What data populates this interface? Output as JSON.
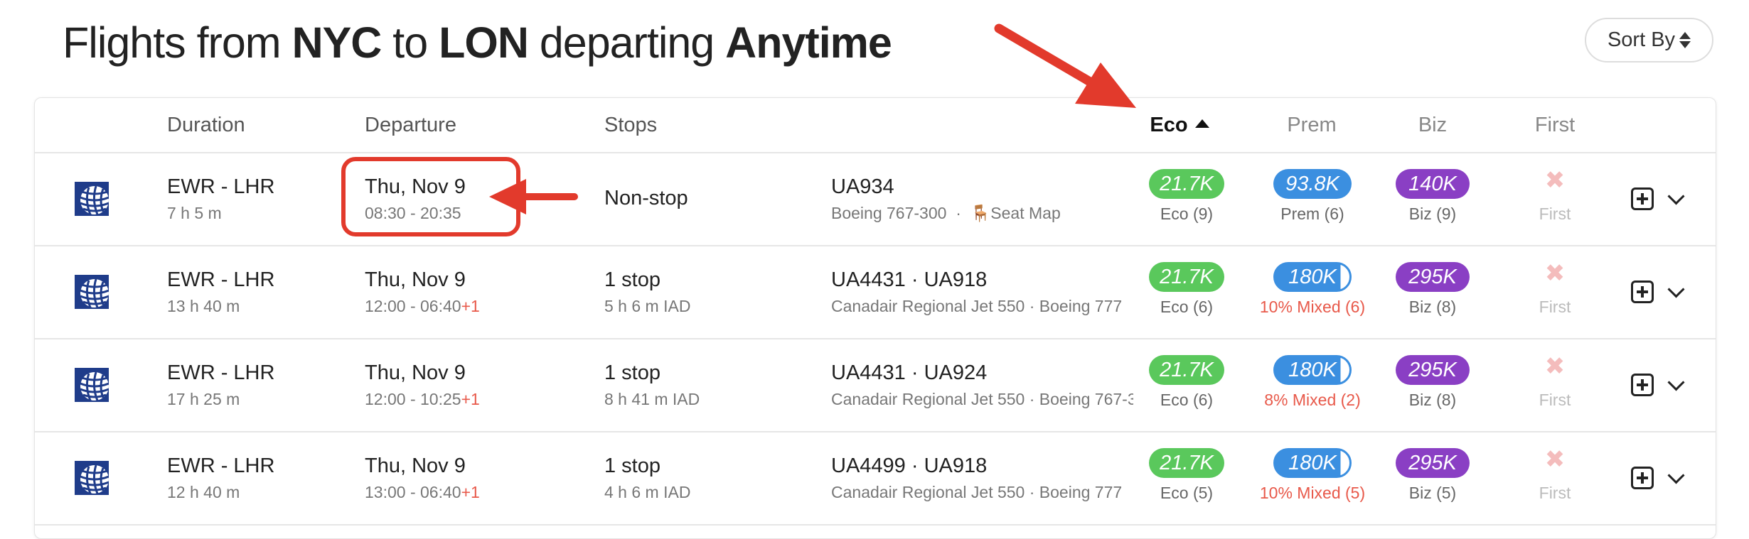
{
  "header": {
    "prefix": "Flights from ",
    "origin": "NYC",
    "mid": " to ",
    "destination": "LON",
    "mid2": " departing ",
    "when": "Anytime"
  },
  "sort_by_label": "Sort By",
  "columns": {
    "duration": "Duration",
    "departure": "Departure",
    "stops": "Stops",
    "eco": "Eco",
    "prem": "Prem",
    "biz": "Biz",
    "first": "First"
  },
  "flights": [
    {
      "route": "EWR - LHR",
      "duration": "7 h 5 m",
      "date": "Thu, Nov 9",
      "times": "08:30 - 20:35",
      "plus_day": "",
      "stops": "Non-stop",
      "stops_detail": "",
      "flight_numbers": "UA934",
      "aircraft": "Boeing 767-300",
      "sep": "·",
      "seat_map": "Seat Map",
      "eco": {
        "price": "21.7K",
        "label": "Eco (9)"
      },
      "prem": {
        "price": "93.8K",
        "label": "Prem (6)",
        "mixed": false
      },
      "biz": {
        "price": "140K",
        "label": "Biz (9)"
      },
      "first": {
        "label": "First"
      }
    },
    {
      "route": "EWR - LHR",
      "duration": "13 h 40 m",
      "date": "Thu, Nov 9",
      "times": "12:00 - 06:40",
      "plus_day": "+1",
      "stops": "1 stop",
      "stops_detail": "5 h 6 m  IAD",
      "flight_numbers": "UA4431  ·  UA918",
      "aircraft": "Canadair Regional Jet 550   ·   Boeing 777",
      "eco": {
        "price": "21.7K",
        "label": "Eco (6)"
      },
      "prem": {
        "price": "180K",
        "label": "10% Mixed (6)",
        "mixed": true
      },
      "biz": {
        "price": "295K",
        "label": "Biz (8)"
      },
      "first": {
        "label": "First"
      }
    },
    {
      "route": "EWR - LHR",
      "duration": "17 h 25 m",
      "date": "Thu, Nov 9",
      "times": "12:00 - 10:25",
      "plus_day": "+1",
      "stops": "1 stop",
      "stops_detail": "8 h 41 m  IAD",
      "flight_numbers": "UA4431  ·  UA924",
      "aircraft": "Canadair Regional Jet 550   ·   Boeing 767-3",
      "eco": {
        "price": "21.7K",
        "label": "Eco (6)"
      },
      "prem": {
        "price": "180K",
        "label": "8% Mixed (2)",
        "mixed": true
      },
      "biz": {
        "price": "295K",
        "label": "Biz (8)"
      },
      "first": {
        "label": "First"
      }
    },
    {
      "route": "EWR - LHR",
      "duration": "12 h 40 m",
      "date": "Thu, Nov 9",
      "times": "13:00 - 06:40",
      "plus_day": "+1",
      "stops": "1 stop",
      "stops_detail": "4 h 6 m  IAD",
      "flight_numbers": "UA4499  ·  UA918",
      "aircraft": "Canadair Regional Jet 550   ·   Boeing 777",
      "eco": {
        "price": "21.7K",
        "label": "Eco (5)"
      },
      "prem": {
        "price": "180K",
        "label": "10% Mixed (5)",
        "mixed": true
      },
      "biz": {
        "price": "295K",
        "label": "Biz (5)"
      },
      "first": {
        "label": "First"
      }
    }
  ],
  "icons": {
    "airline": "united-airlines-globe-icon",
    "seat": "seat-icon",
    "unavailable": "x-mark-icon",
    "expand": "plus-square-icon",
    "chevron": "chevron-down-icon",
    "annotation": "red-arrow-icon"
  },
  "colors": {
    "eco": "#5ac85c",
    "prem": "#3b8fe0",
    "biz": "#8a3fc4",
    "annotation": "#e23a2c",
    "mixed_text": "#e8594a"
  }
}
